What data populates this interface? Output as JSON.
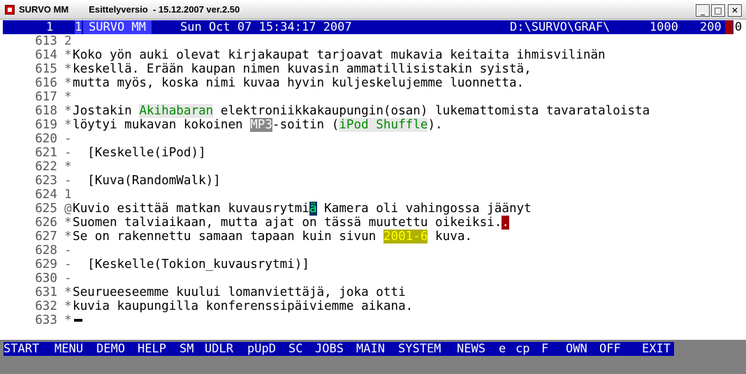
{
  "window": {
    "app_name": "SURVO MM",
    "title_detail": "Esittelyversio  - 15.12.2007 ver.2.50",
    "minimize": "_",
    "maximize": "□",
    "close": "✕"
  },
  "status": {
    "window_num": "1",
    "marker": "1",
    "program": "SURVO MM",
    "datetime": "Sun Oct 07 15:34:17 2007",
    "path": "D:\\SURVO\\GRAF\\",
    "edit_lines": "1000",
    "edit_cols": "200",
    "indicator": "0"
  },
  "editor": {
    "lines": [
      {
        "num": "613",
        "ctrl": "2",
        "parts": [
          {
            "t": ""
          }
        ]
      },
      {
        "num": "614",
        "ctrl": "*",
        "parts": [
          {
            "t": "Koko yön auki olevat kirjakaupat tarjoavat mukavia keitaita ihmisvilinän"
          }
        ]
      },
      {
        "num": "615",
        "ctrl": "*",
        "parts": [
          {
            "t": "keskellä. Erään kaupan nimen kuvasin ammatillisistakin syistä,"
          }
        ]
      },
      {
        "num": "616",
        "ctrl": "*",
        "parts": [
          {
            "t": "mutta myös, koska nimi kuvaa hyvin kuljeskelujemme luonnetta."
          }
        ]
      },
      {
        "num": "617",
        "ctrl": "*",
        "parts": [
          {
            "t": ""
          }
        ]
      },
      {
        "num": "618",
        "ctrl": "*",
        "parts": [
          {
            "t": "Jostakin "
          },
          {
            "t": "Akihabaran",
            "c": "hl-green"
          },
          {
            "t": " elektroniikkakaupungin(osan) lukemattomista tavarataloista"
          }
        ]
      },
      {
        "num": "619",
        "ctrl": "*",
        "parts": [
          {
            "t": "löytyi mukavan kokoinen "
          },
          {
            "t": "MP3",
            "c": "hl-gray"
          },
          {
            "t": "-soitin ("
          },
          {
            "t": "iPod Shuffle",
            "c": "hl-green"
          },
          {
            "t": ")."
          }
        ]
      },
      {
        "num": "620",
        "ctrl": "-",
        "parts": [
          {
            "t": ""
          }
        ]
      },
      {
        "num": "621",
        "ctrl": "-",
        "parts": [
          {
            "t": "  [Keskelle(iPod)]"
          }
        ]
      },
      {
        "num": "622",
        "ctrl": "*",
        "parts": [
          {
            "t": ""
          }
        ]
      },
      {
        "num": "623",
        "ctrl": "-",
        "parts": [
          {
            "t": "  [Kuva(RandomWalk)]"
          }
        ]
      },
      {
        "num": "624",
        "ctrl": "1",
        "parts": [
          {
            "t": ""
          }
        ]
      },
      {
        "num": "625",
        "ctrl": "@",
        "parts": [
          {
            "t": "Kuvio esittää matkan kuvausrytmi"
          },
          {
            "t": "ä",
            "c": "hl-cursor"
          },
          {
            "t": " Kamera oli vahingossa jäänyt"
          }
        ]
      },
      {
        "num": "626",
        "ctrl": "*",
        "parts": [
          {
            "t": "Suomen talviaikaan, mutta ajat on tässä muutettu oikeiksi."
          },
          {
            "t": ".",
            "c": "hl-red"
          }
        ]
      },
      {
        "num": "627",
        "ctrl": "*",
        "parts": [
          {
            "t": "Se on rakennettu samaan tapaan kuin sivun "
          },
          {
            "t": "2001-6",
            "c": "hl-yellow"
          },
          {
            "t": " kuva."
          }
        ]
      },
      {
        "num": "628",
        "ctrl": "-",
        "parts": [
          {
            "t": ""
          }
        ]
      },
      {
        "num": "629",
        "ctrl": "-",
        "parts": [
          {
            "t": "  [Keskelle(Tokion_kuvausrytmi)]"
          }
        ]
      },
      {
        "num": "630",
        "ctrl": "-",
        "parts": [
          {
            "t": ""
          }
        ]
      },
      {
        "num": "631",
        "ctrl": "*",
        "parts": [
          {
            "t": "Seurueeseemme kuului lomanviettäjä, joka otti"
          }
        ]
      },
      {
        "num": "632",
        "ctrl": "*",
        "parts": [
          {
            "t": "kuvia kaupungilla konferenssipäiviemme aikana."
          }
        ]
      },
      {
        "num": "633",
        "ctrl": "*",
        "parts": [
          {
            "t": ""
          }
        ]
      }
    ]
  },
  "menu": {
    "items": [
      "START",
      "MENU",
      "DEMO",
      "HELP",
      "SM",
      "UDLR",
      "pUpD",
      "SC",
      "JOBS",
      "MAIN",
      "SYSTEM",
      "NEWS",
      "e",
      "cp",
      "F",
      "OWN",
      "OFF",
      "EXIT"
    ]
  }
}
